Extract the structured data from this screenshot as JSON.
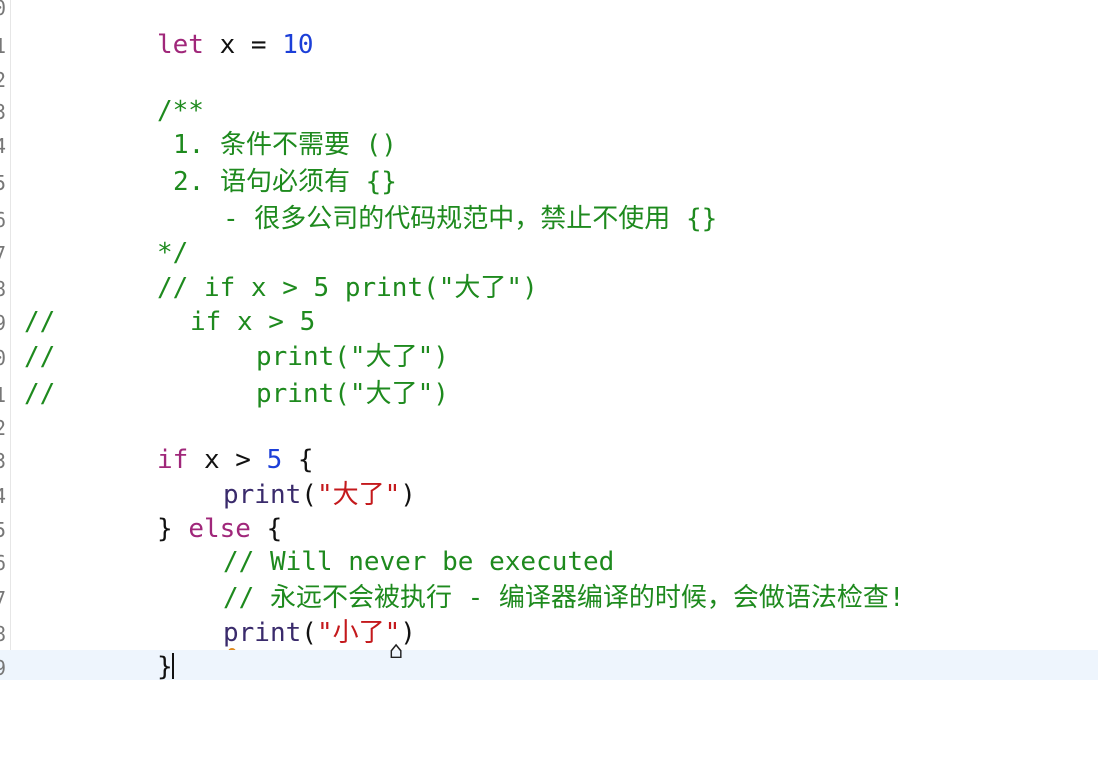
{
  "editor": {
    "line_numbers": [
      "0",
      "1",
      "2",
      "3",
      "4",
      "5",
      "6",
      "7",
      "8",
      "9",
      "0",
      "1",
      "2",
      "3",
      "4",
      "5",
      "6",
      "7",
      "8",
      "9"
    ],
    "lines": {
      "l1": {
        "kw": "let",
        "rest": " x = ",
        "num": "10"
      },
      "l3": {
        "cmt": "/**"
      },
      "l4": {
        "cmt": "1. 条件不需要 ()"
      },
      "l5": {
        "cmt": "2. 语句必须有 {}"
      },
      "l6": {
        "cmt": "- 很多公司的代码规范中，禁止不使用 {}"
      },
      "l7": {
        "cmt": "*/"
      },
      "l8": {
        "cmt": "// if x > 5 print(\"大了\")"
      },
      "l9": {
        "cmt_a": "//",
        "cmt_b": "if x > 5"
      },
      "l10": {
        "cmt_a": "//",
        "cmt_b": "print(\"大了\")"
      },
      "l11": {
        "cmt_a": "//",
        "cmt_b": "print(\"大了\")"
      },
      "l13": {
        "kw": "if",
        "rest": " x > ",
        "num": "5",
        "tail": " {"
      },
      "l14": {
        "fn": "print",
        "open": "(",
        "str": "\"大了\"",
        "close": ")"
      },
      "l15": {
        "a": "} ",
        "kw": "else",
        "b": " {"
      },
      "l16": {
        "cmt": "// Will never be executed"
      },
      "l17": {
        "cmt": "// 永远不会被执行 - 编译器编译的时候，会做语法检查!"
      },
      "l18": {
        "fn": "print",
        "open": "(",
        "str": "\"小了\"",
        "close": ")"
      },
      "l19": {
        "plain": "}"
      }
    }
  },
  "colors": {
    "keyword": "#a0277a",
    "number": "#1c3fd8",
    "string": "#c4191c",
    "comment": "#1e8a1e",
    "function": "#3a2b6c",
    "current_line": "#eef5fd"
  }
}
